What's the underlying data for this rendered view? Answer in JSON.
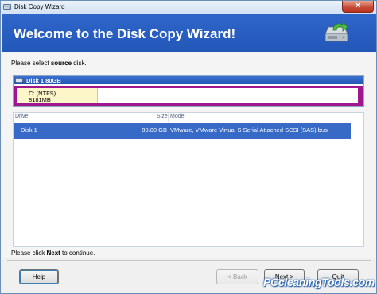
{
  "window": {
    "title": "Disk Copy Wizard",
    "close_glyph": "✕"
  },
  "header": {
    "title": "Welcome to the Disk Copy Wizard!",
    "icon": "disk-copy-icon"
  },
  "source": {
    "label_prefix": "Please select ",
    "label_bold": "source",
    "label_suffix": " disk."
  },
  "disk_panel": {
    "bar_label": "Disk 1   80GB",
    "partition": {
      "name": "C: (NTFS)",
      "size": "8181MB"
    }
  },
  "table": {
    "columns": [
      "Drive",
      "Size",
      "Model"
    ],
    "rows": [
      {
        "drive": "Disk 1",
        "size": "80.00 GB",
        "model": "VMware,  VMware Virtual S Serial Attached SCSI (SAS) bus"
      }
    ]
  },
  "footer": {
    "note_prefix": "Please click ",
    "note_bold": "Next",
    "note_suffix": " to continue."
  },
  "buttons": {
    "help": {
      "mnemonic": "H",
      "rest": "elp"
    },
    "back": {
      "prefix": "< ",
      "mnemonic": "B",
      "rest": "ack"
    },
    "next": {
      "mnemonic": "N",
      "rest": "ext >"
    },
    "quit": {
      "mnemonic": "Q",
      "rest": "uit"
    }
  },
  "watermark": "PCcleaningTools.com",
  "colors": {
    "header_bg": "#2a5fc2",
    "selection": "#3769c6",
    "partition_border": "#a0168e"
  }
}
